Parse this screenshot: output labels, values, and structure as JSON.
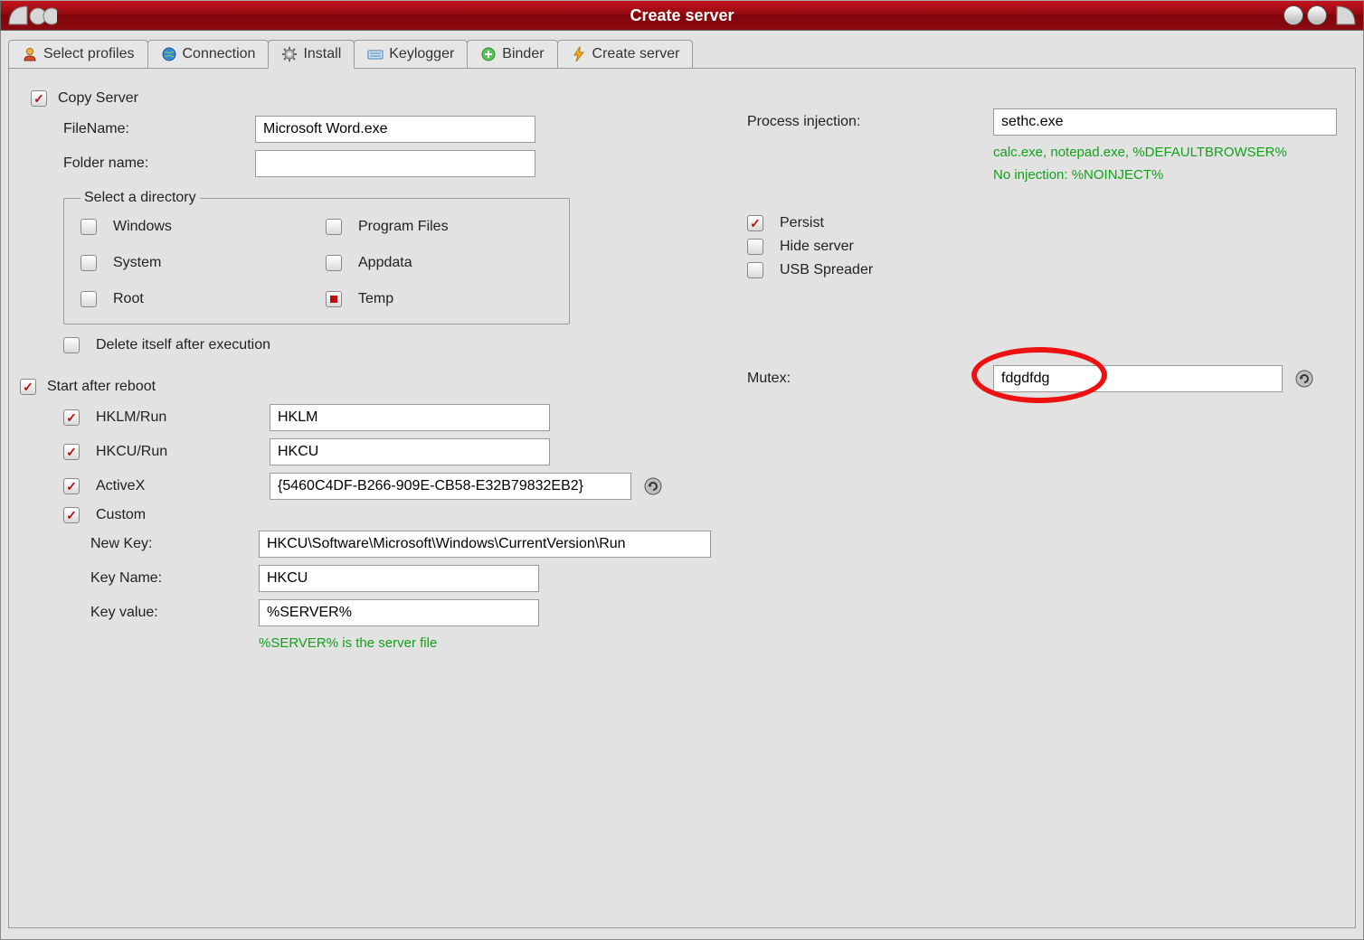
{
  "window": {
    "title": "Create server"
  },
  "tabs": [
    {
      "label": "Select profiles",
      "icon": "user-icon"
    },
    {
      "label": "Connection",
      "icon": "globe-icon"
    },
    {
      "label": "Install",
      "icon": "gear-icon",
      "active": true
    },
    {
      "label": "Keylogger",
      "icon": "keyboard-icon"
    },
    {
      "label": "Binder",
      "icon": "plus-circle-icon"
    },
    {
      "label": "Create server",
      "icon": "lightning-icon"
    }
  ],
  "copy_server": {
    "section_label": "Copy Server",
    "checked": true,
    "filename_label": "FileName:",
    "filename_value": "Microsoft Word.exe",
    "folder_label": "Folder name:",
    "folder_value": "",
    "directory": {
      "legend": "Select a directory",
      "options": {
        "windows": {
          "label": "Windows",
          "checked": false
        },
        "program": {
          "label": "Program Files",
          "checked": false
        },
        "system": {
          "label": "System",
          "checked": false
        },
        "appdata": {
          "label": "Appdata",
          "checked": false
        },
        "root": {
          "label": "Root",
          "checked": false
        },
        "temp": {
          "label": "Temp",
          "checked": true
        }
      }
    },
    "delete_self": {
      "label": "Delete itself after execution",
      "checked": false
    }
  },
  "start_after_reboot": {
    "section_label": "Start after reboot",
    "checked": true,
    "hklm_run": {
      "label": "HKLM/Run",
      "checked": true,
      "value": "HKLM"
    },
    "hkcu_run": {
      "label": "HKCU/Run",
      "checked": true,
      "value": "HKCU"
    },
    "activex": {
      "label": "ActiveX",
      "checked": true,
      "value": "{5460C4DF-B266-909E-CB58-E32B79832EB2}"
    },
    "custom": {
      "label": "Custom",
      "checked": true
    },
    "custom_keys": {
      "new_key": {
        "label": "New Key:",
        "value": "HKCU\\Software\\Microsoft\\Windows\\CurrentVersion\\Run"
      },
      "key_name": {
        "label": "Key Name:",
        "value": "HKCU"
      },
      "key_value": {
        "label": "Key value:",
        "value": "%SERVER%"
      }
    },
    "server_note": "%SERVER% is the server file"
  },
  "right": {
    "process_injection": {
      "label": "Process injection:",
      "value": "sethc.exe",
      "hint_line1": "calc.exe, notepad.exe, %DEFAULTBROWSER%",
      "hint_line2": "No injection: %NOINJECT%"
    },
    "persist": {
      "label": "Persist",
      "checked": true
    },
    "hide_server": {
      "label": "Hide server",
      "checked": false
    },
    "usb_spreader": {
      "label": "USB Spreader",
      "checked": false
    },
    "mutex": {
      "label": "Mutex:",
      "value": "fdgdfdg"
    }
  }
}
